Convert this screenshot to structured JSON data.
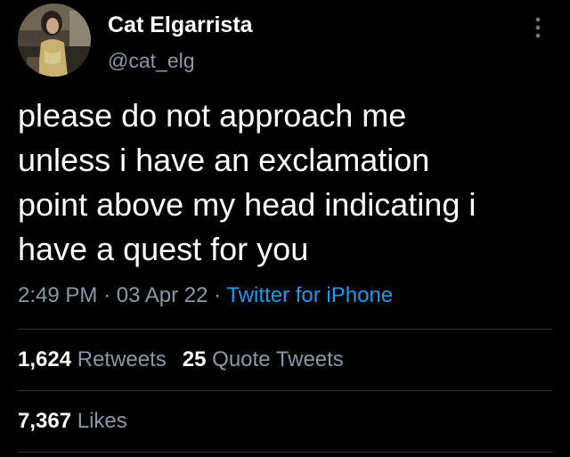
{
  "user": {
    "display_name": "Cat Elgarrista",
    "handle": "@cat_elg"
  },
  "tweet": {
    "lines": [
      "please do not approach me",
      "unless i have an exclamation",
      "point above my head indicating i",
      "have a quest for you"
    ]
  },
  "meta": {
    "time": "2:49 PM",
    "separator": "·",
    "date": "03 Apr 22",
    "source": "Twitter for iPhone"
  },
  "stats": {
    "retweets_count": "1,624",
    "retweets_label": "Retweets",
    "quotes_count": "25",
    "quotes_label": "Quote Tweets",
    "likes_count": "7,367",
    "likes_label": "Likes"
  },
  "icons": {
    "more": "more-vertical-icon"
  },
  "colors": {
    "background": "#000000",
    "text": "#ffffff",
    "secondary": "#8b98a5",
    "link": "#1d9bf0",
    "divider": "#2f3336"
  }
}
